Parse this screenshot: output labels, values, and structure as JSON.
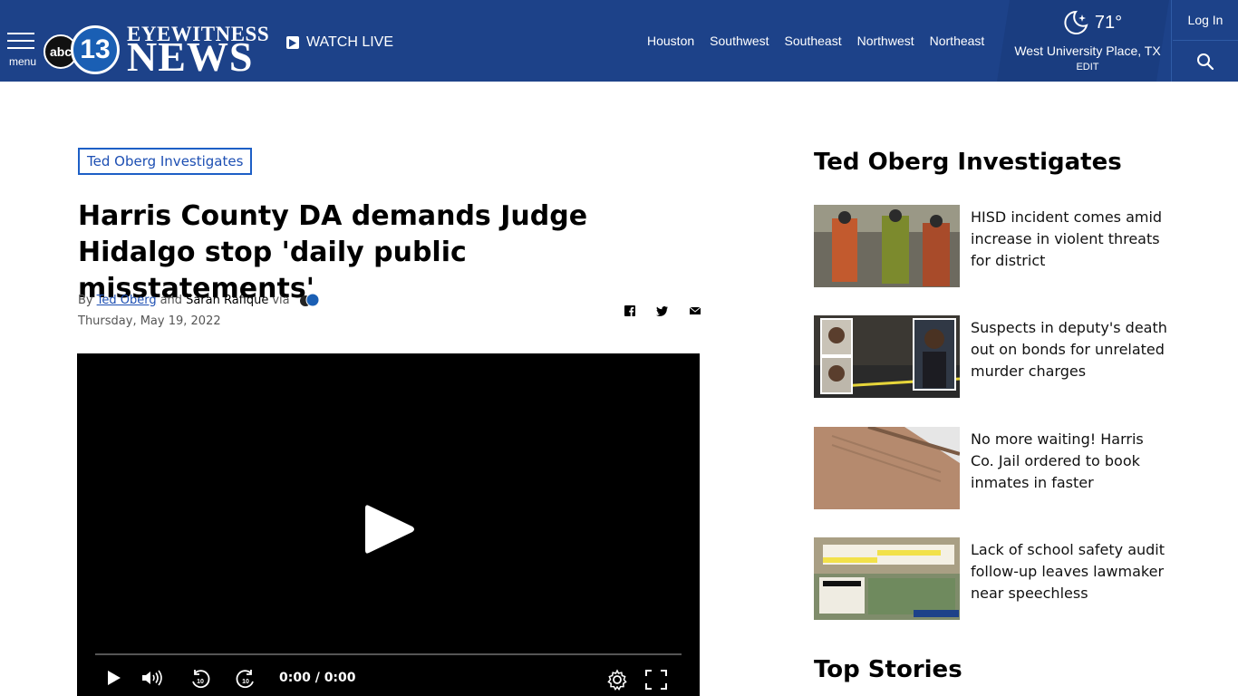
{
  "header": {
    "menu_label": "menu",
    "logo": {
      "abc": "abc",
      "number": "13",
      "eyewitness": "EYEWITNESS",
      "news": "NEWS"
    },
    "watch_live": "WATCH LIVE",
    "regions": [
      "Houston",
      "Southwest",
      "Southeast",
      "Northwest",
      "Northeast"
    ],
    "weather": {
      "temp": "71°",
      "location": "West University Place, TX",
      "edit": "EDIT",
      "icon": "moon-stars-icon"
    },
    "login": "Log In",
    "colors": {
      "bar": "#1d4289",
      "accent": "#1d5fc6"
    }
  },
  "article": {
    "tag": "Ted Oberg Investigates",
    "headline": "Harris County DA demands Judge Hidalgo stop 'daily public misstatements'",
    "byline": {
      "by": "By",
      "author1": "Ted Oberg",
      "and": "and",
      "author2": "Sarah Rafique",
      "via": "via"
    },
    "date": "Thursday, May 19, 2022",
    "share": [
      "facebook-icon",
      "twitter-icon",
      "email-icon"
    ],
    "video": {
      "time_current": "0:00",
      "time_total": "/ 0:00",
      "progress": 0
    }
  },
  "sidebar": {
    "title": "Ted Oberg Investigates",
    "stories": [
      {
        "title": "HISD incident comes amid increase in violent threats for district"
      },
      {
        "title": "Suspects in deputy's death out on bonds for unrelated murder charges"
      },
      {
        "title": "No more waiting! Harris Co. Jail ordered to book inmates in faster"
      },
      {
        "title": "Lack of school safety audit follow-up leaves lawmaker near speechless"
      }
    ],
    "top_stories": "Top Stories"
  }
}
